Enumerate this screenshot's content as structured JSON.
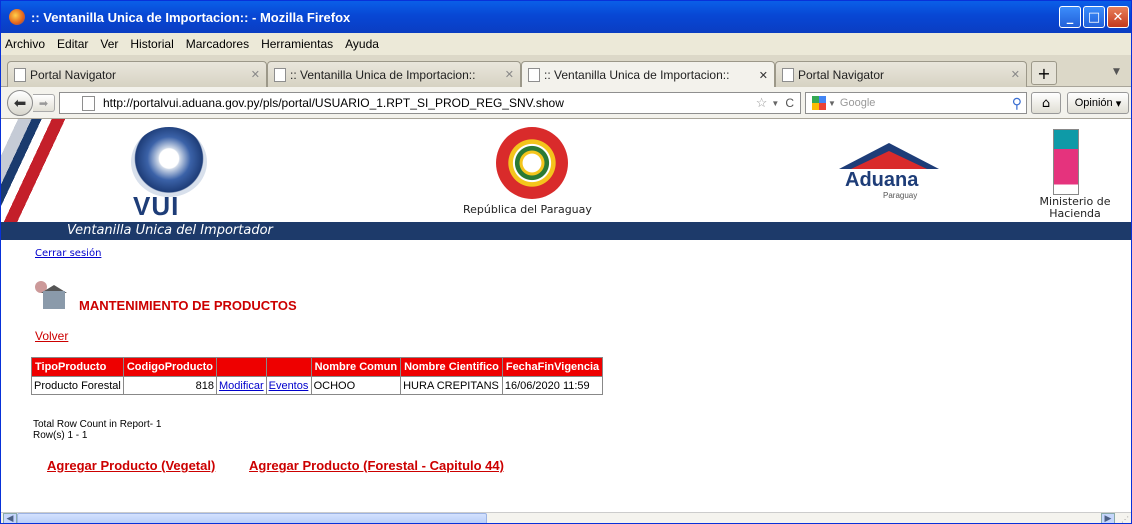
{
  "window": {
    "title": ":: Ventanilla Unica de Importacion:: - Mozilla Firefox"
  },
  "menu": [
    "Archivo",
    "Editar",
    "Ver",
    "Historial",
    "Marcadores",
    "Herramientas",
    "Ayuda"
  ],
  "tabs": [
    {
      "label": "Portal Navigator"
    },
    {
      "label": ":: Ventanilla Unica de Importacion::"
    },
    {
      "label": ":: Ventanilla Unica de Importacion::"
    },
    {
      "label": "Portal Navigator"
    }
  ],
  "navbar": {
    "url": "http://portalvui.aduana.gov.py/pls/portal/USUARIO_1.RPT_SI_PROD_REG_SNV.show",
    "search_placeholder": "Google",
    "opinion_label": "Opinión"
  },
  "banner": {
    "vui_text": "VUI",
    "seal_caption": "República del Paraguay",
    "aduana_text": "Aduana",
    "aduana_sub": "Paraguay",
    "ministry_caption": "Ministerio de Hacienda",
    "tagline": "Ventanilla Unica del Importador"
  },
  "page": {
    "logout": "Cerrar sesión",
    "title": "MANTENIMIENTO DE PRODUCTOS",
    "back": "Volver",
    "total": "Total Row Count in Report- 1",
    "rows_range": "Row(s) 1 - 1",
    "add_vegetal": "Agregar Producto (Vegetal)",
    "add_forestal": "Agregar Producto (Forestal - Capitulo 44)"
  },
  "table": {
    "headers": [
      "TipoProducto",
      "CodigoProducto",
      "",
      "",
      "Nombre Comun",
      "Nombre Cientifico",
      "FechaFinVigencia"
    ],
    "rows": [
      {
        "tipo": "Producto Forestal",
        "codigo": "818",
        "modificar": "Modificar",
        "eventos": "Eventos",
        "comun": "OCHOO",
        "cientifico": "HURA CREPITANS",
        "fecha": "16/06/2020 11:59"
      }
    ]
  }
}
